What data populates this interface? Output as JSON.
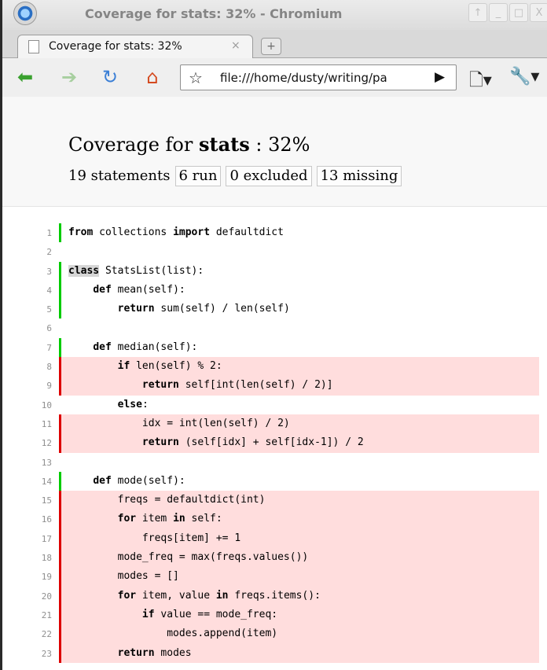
{
  "window": {
    "title": "Coverage for stats: 32% - Chromium",
    "controls": [
      "↑",
      "_",
      "□",
      "X"
    ]
  },
  "tab": {
    "label": "Coverage for stats: 32%",
    "close": "×",
    "new_tab": "+"
  },
  "toolbar": {
    "url": "file:///home/dusty/writing/pa",
    "star": "☆",
    "go": "▶",
    "page_menu": "🗋▾",
    "wrench_menu": "🔧▾"
  },
  "coverage": {
    "title_prefix": "Coverage for ",
    "module": "stats",
    "title_suffix": " : 32%",
    "statements": "19 statements",
    "run": "6 run",
    "excluded": "0 excluded",
    "missing": "13 missing"
  },
  "source_lines": [
    {
      "n": "1",
      "status": "run",
      "tokens": [
        {
          "t": "from",
          "k": 1
        },
        {
          "t": " collections "
        },
        {
          "t": "import",
          "k": 1
        },
        {
          "t": " defaultdict"
        }
      ]
    },
    {
      "n": "2",
      "status": "",
      "tokens": []
    },
    {
      "n": "3",
      "status": "run",
      "tokens": [
        {
          "t": "class",
          "k": 2
        },
        {
          "t": " StatsList(list):"
        }
      ]
    },
    {
      "n": "4",
      "status": "run",
      "tokens": [
        {
          "t": "    "
        },
        {
          "t": "def",
          "k": 1
        },
        {
          "t": " mean(self):"
        }
      ]
    },
    {
      "n": "5",
      "status": "run",
      "tokens": [
        {
          "t": "        "
        },
        {
          "t": "return",
          "k": 1
        },
        {
          "t": " sum(self) / len(self)"
        }
      ]
    },
    {
      "n": "6",
      "status": "",
      "tokens": []
    },
    {
      "n": "7",
      "status": "run",
      "tokens": [
        {
          "t": "    "
        },
        {
          "t": "def",
          "k": 1
        },
        {
          "t": " median(self):"
        }
      ]
    },
    {
      "n": "8",
      "status": "mis",
      "tokens": [
        {
          "t": "        "
        },
        {
          "t": "if",
          "k": 1
        },
        {
          "t": " len(self) % 2:"
        }
      ]
    },
    {
      "n": "9",
      "status": "mis",
      "tokens": [
        {
          "t": "            "
        },
        {
          "t": "return",
          "k": 1
        },
        {
          "t": " self[int(len(self) / 2)]"
        }
      ]
    },
    {
      "n": "10",
      "status": "",
      "tokens": [
        {
          "t": "        "
        },
        {
          "t": "else",
          "k": 1
        },
        {
          "t": ":"
        }
      ]
    },
    {
      "n": "11",
      "status": "mis",
      "tokens": [
        {
          "t": "            idx = int(len(self) / 2)"
        }
      ]
    },
    {
      "n": "12",
      "status": "mis",
      "tokens": [
        {
          "t": "            "
        },
        {
          "t": "return",
          "k": 1
        },
        {
          "t": " (self[idx] + self[idx-1]) / 2"
        }
      ]
    },
    {
      "n": "13",
      "status": "",
      "tokens": []
    },
    {
      "n": "14",
      "status": "run",
      "tokens": [
        {
          "t": "    "
        },
        {
          "t": "def",
          "k": 1
        },
        {
          "t": " mode(self):"
        }
      ]
    },
    {
      "n": "15",
      "status": "mis",
      "tokens": [
        {
          "t": "        freqs = defaultdict(int)"
        }
      ]
    },
    {
      "n": "16",
      "status": "mis",
      "tokens": [
        {
          "t": "        "
        },
        {
          "t": "for",
          "k": 1
        },
        {
          "t": " item "
        },
        {
          "t": "in",
          "k": 1
        },
        {
          "t": " self:"
        }
      ]
    },
    {
      "n": "17",
      "status": "mis",
      "tokens": [
        {
          "t": "            freqs[item] += 1"
        }
      ]
    },
    {
      "n": "18",
      "status": "mis",
      "tokens": [
        {
          "t": "        mode_freq = max(freqs.values())"
        }
      ]
    },
    {
      "n": "19",
      "status": "mis",
      "tokens": [
        {
          "t": "        modes = []"
        }
      ]
    },
    {
      "n": "20",
      "status": "mis",
      "tokens": [
        {
          "t": "        "
        },
        {
          "t": "for",
          "k": 1
        },
        {
          "t": " item, value "
        },
        {
          "t": "in",
          "k": 1
        },
        {
          "t": " freqs.items():"
        }
      ]
    },
    {
      "n": "21",
      "status": "mis",
      "tokens": [
        {
          "t": "            "
        },
        {
          "t": "if",
          "k": 1
        },
        {
          "t": " value == mode_freq:"
        }
      ]
    },
    {
      "n": "22",
      "status": "mis",
      "tokens": [
        {
          "t": "                modes.append(item)"
        }
      ]
    },
    {
      "n": "23",
      "status": "mis",
      "tokens": [
        {
          "t": "        "
        },
        {
          "t": "return",
          "k": 1
        },
        {
          "t": " modes"
        }
      ]
    }
  ],
  "colors": {
    "run_marker": "#00cc00",
    "missing_marker": "#dd0000",
    "missing_background": "#ffdddd"
  }
}
